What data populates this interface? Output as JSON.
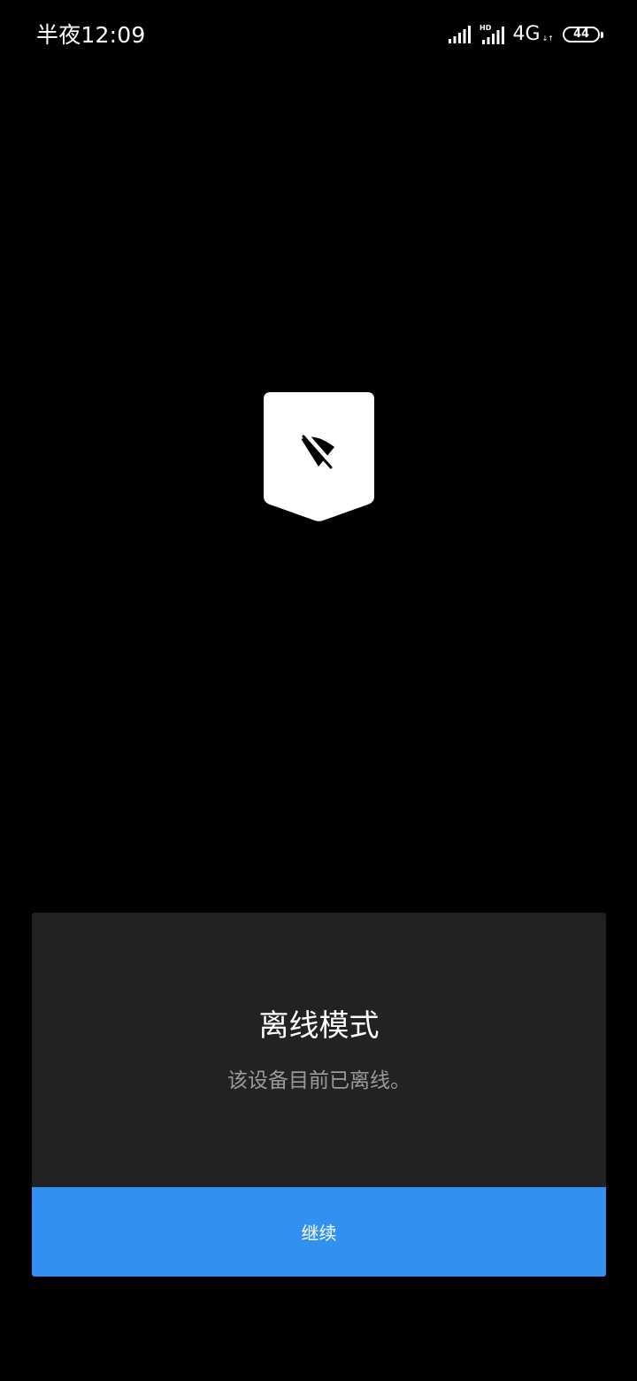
{
  "status_bar": {
    "time": "半夜12:09",
    "network_type": "4G",
    "network_arrows": "↓↑",
    "battery_level": "44",
    "hd_label": "HD",
    "icons": [
      "signal-icon",
      "hd-signal-icon",
      "network-activity-icon",
      "battery-icon"
    ]
  },
  "emblem": {
    "icon": "wifi-off-icon",
    "background_color": "#ffffff",
    "glyph_color": "#000000"
  },
  "dialog": {
    "title": "离线模式",
    "message": "该设备目前已离线。",
    "continue_label": "继续",
    "background_color": "#222222",
    "button_color": "#3291f0"
  }
}
